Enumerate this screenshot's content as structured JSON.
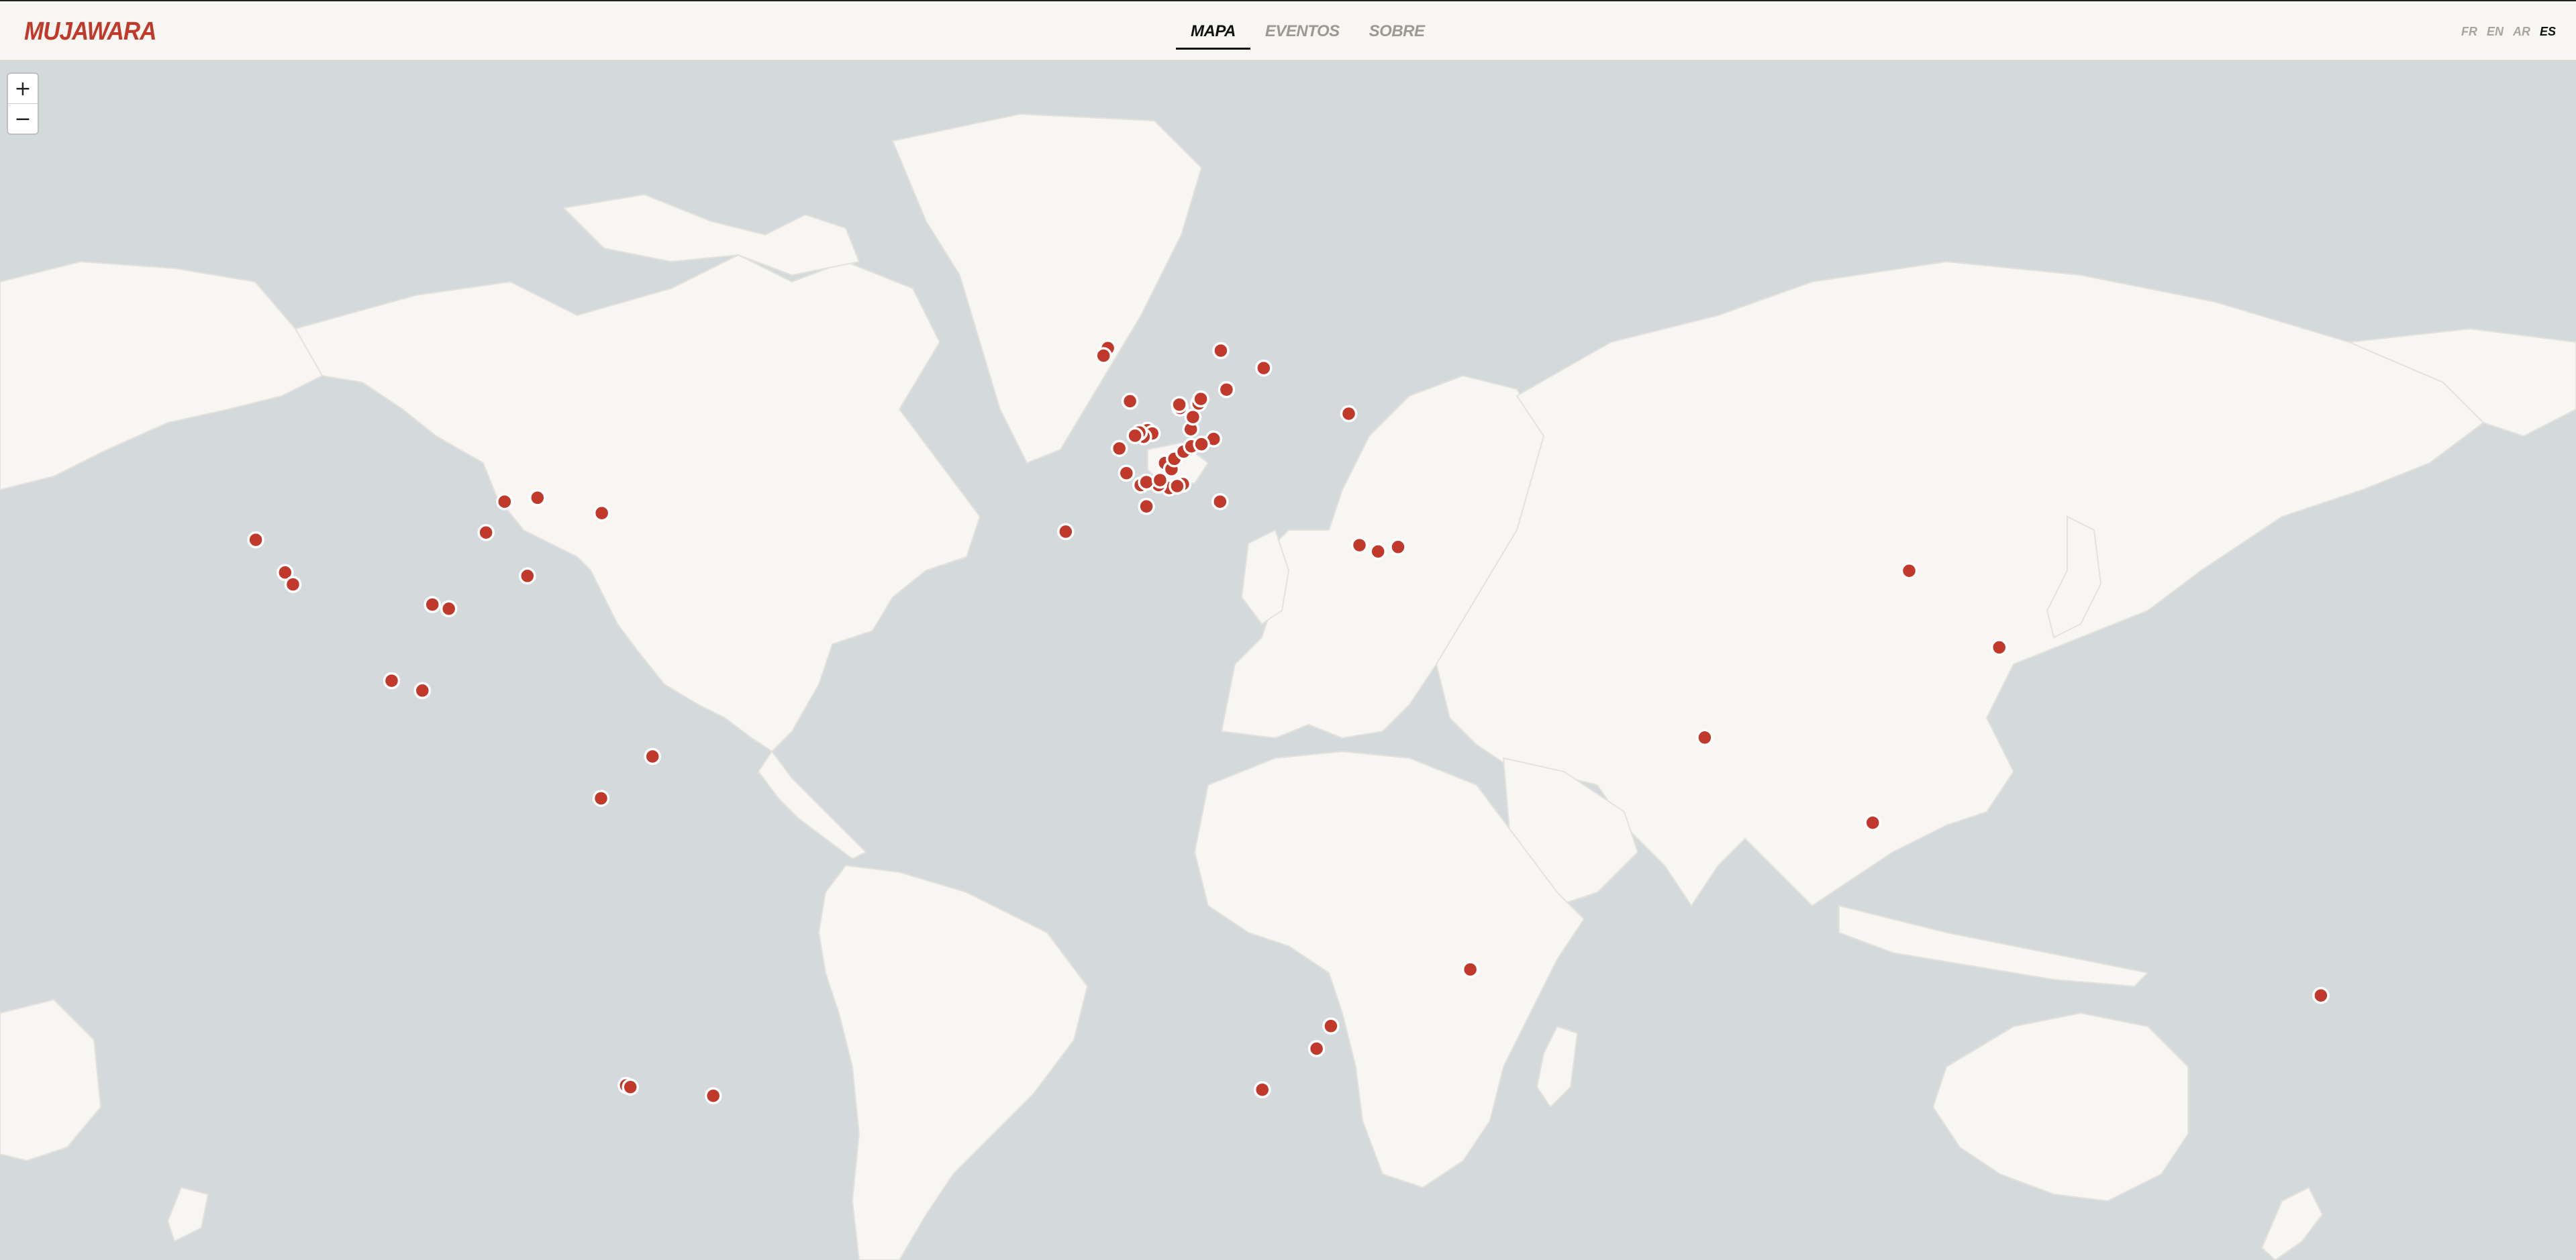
{
  "header": {
    "logo": "MUJAWARA",
    "tabs": [
      {
        "label": "MAPA",
        "active": true
      },
      {
        "label": "EVENTOS",
        "active": false
      },
      {
        "label": "SOBRE",
        "active": false
      }
    ],
    "languages": [
      {
        "label": "FR",
        "active": false
      },
      {
        "label": "EN",
        "active": false
      },
      {
        "label": "AR",
        "active": false
      },
      {
        "label": "ES",
        "active": true
      }
    ]
  },
  "map": {
    "zoom_in_label": "+",
    "zoom_out_label": "−",
    "colors": {
      "ocean": "#d4d9dc",
      "land": "#f7f6f3",
      "marker": "#c0392b",
      "marker_stroke": "#ffffff"
    },
    "event_count": 74,
    "events": [
      {
        "lat": 37.8,
        "lon": -122.4
      },
      {
        "lat": 34.1,
        "lon": -118.3
      },
      {
        "lat": 32.7,
        "lon": -117.2
      },
      {
        "lat": 41.9,
        "lon": -87.6
      },
      {
        "lat": 42.3,
        "lon": -83.0
      },
      {
        "lat": 40.7,
        "lon": -74.0
      },
      {
        "lat": 38.6,
        "lon": -90.2
      },
      {
        "lat": 33.7,
        "lon": -84.4
      },
      {
        "lat": 29.8,
        "lon": -95.4
      },
      {
        "lat": 30.3,
        "lon": -97.7
      },
      {
        "lat": 20.7,
        "lon": -103.4
      },
      {
        "lat": 19.4,
        "lon": -99.1
      },
      {
        "lat": 4.7,
        "lon": -74.1
      },
      {
        "lat": 10.5,
        "lon": -66.9
      },
      {
        "lat": -33.4,
        "lon": -70.6
      },
      {
        "lat": -33.6,
        "lon": -70.0
      },
      {
        "lat": -34.6,
        "lon": -58.4
      },
      {
        "lat": 55.9,
        "lon": -3.2
      },
      {
        "lat": 55.3,
        "lon": -3.8
      },
      {
        "lat": 51.5,
        "lon": -0.1
      },
      {
        "lat": 48.9,
        "lon": 2.35
      },
      {
        "lat": 48.6,
        "lon": 3.0
      },
      {
        "lat": 48.3,
        "lon": 1.8
      },
      {
        "lat": 48.7,
        "lon": 1.2
      },
      {
        "lat": 48.4,
        "lon": 0.6
      },
      {
        "lat": 47.2,
        "lon": -1.6
      },
      {
        "lat": 45.8,
        "lon": 4.8
      },
      {
        "lat": 45.2,
        "lon": 5.7
      },
      {
        "lat": 44.8,
        "lon": -0.6
      },
      {
        "lat": 43.6,
        "lon": 1.4
      },
      {
        "lat": 43.3,
        "lon": 5.4
      },
      {
        "lat": 43.7,
        "lon": 7.3
      },
      {
        "lat": 43.6,
        "lon": 3.9
      },
      {
        "lat": 43.9,
        "lon": 2.2
      },
      {
        "lat": 44.1,
        "lon": 4.1
      },
      {
        "lat": 43.5,
        "lon": 6.5
      },
      {
        "lat": 41.4,
        "lon": 2.2
      },
      {
        "lat": 46.2,
        "lon": 6.1
      },
      {
        "lat": 46.9,
        "lon": 7.4
      },
      {
        "lat": 47.4,
        "lon": 8.5
      },
      {
        "lat": 48.1,
        "lon": 11.6
      },
      {
        "lat": 49.0,
        "lon": 8.4
      },
      {
        "lat": 50.1,
        "lon": 8.7
      },
      {
        "lat": 50.9,
        "lon": 6.9
      },
      {
        "lat": 51.2,
        "lon": 6.8
      },
      {
        "lat": 52.5,
        "lon": 13.4
      },
      {
        "lat": 51.3,
        "lon": 9.5
      },
      {
        "lat": 47.6,
        "lon": 9.9
      },
      {
        "lat": 41.9,
        "lon": 12.5
      },
      {
        "lat": 51.7,
        "lon": 9.8
      },
      {
        "lat": 55.7,
        "lon": 12.6
      },
      {
        "lat": 54.3,
        "lon": 18.6
      },
      {
        "lat": 50.4,
        "lon": 30.5
      },
      {
        "lat": 38.7,
        "lon": -9.1
      },
      {
        "lat": 37.2,
        "lon": 32.0
      },
      {
        "lat": 36.5,
        "lon": 34.6
      },
      {
        "lat": 37.0,
        "lon": 37.4
      },
      {
        "lat": 34.3,
        "lon": 108.9
      },
      {
        "lat": 25.0,
        "lon": 121.5
      },
      {
        "lat": 13.1,
        "lon": 80.3
      },
      {
        "lat": 1.3,
        "lon": 103.8
      },
      {
        "lat": -18.9,
        "lon": 47.5
      },
      {
        "lat": -26.2,
        "lon": 28.0
      },
      {
        "lat": -29.0,
        "lon": 26.0
      },
      {
        "lat": -33.9,
        "lon": 18.4
      },
      {
        "lat": -22.3,
        "lon": 166.5
      }
    ]
  }
}
